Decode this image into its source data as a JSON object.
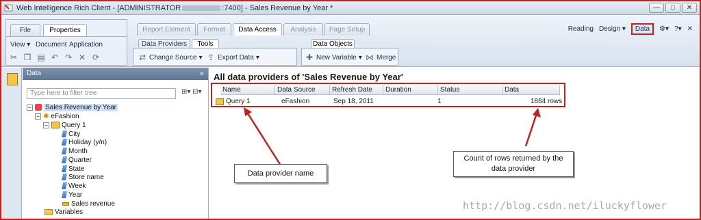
{
  "window": {
    "title_prefix": "Web Intelligence Rich Client - [ADMINISTRATOR",
    "title_suffix": ":7400] - Sales Revenue by Year *",
    "minimize": "—",
    "maximize": "□",
    "close": "✕"
  },
  "left_ribbon": {
    "tabs": [
      "File",
      "Properties"
    ],
    "nav": [
      "View",
      "Document",
      "Application"
    ]
  },
  "main_tabs": [
    "Report Element",
    "Format",
    "Data Access",
    "Analysis",
    "Page Setup"
  ],
  "sub_tabs": [
    "Data Providers",
    "Tools"
  ],
  "data_objects_tab": "Data Objects",
  "tools": {
    "change_source": "Change Source",
    "export_data": "Export Data",
    "new_variable": "New Variable",
    "merge": "Merge"
  },
  "right_tools": {
    "reading": "Reading",
    "design": "Design",
    "data": "Data"
  },
  "data_panel": {
    "header": "Data",
    "collapse": "«",
    "filter_placeholder": "Type here to filter tree",
    "tree": {
      "root": "Sales Revenue by Year",
      "universe": "eFashion",
      "query": "Query 1",
      "objects": [
        "City",
        "Holiday (y/n)",
        "Month",
        "Quarter",
        "State",
        "Store name",
        "Week",
        "Year",
        "Sales revenue"
      ],
      "variables": "Variables"
    }
  },
  "main": {
    "heading": "All data providers of 'Sales Revenue by Year'",
    "columns": [
      "Name",
      "Data Source",
      "Refresh Date",
      "Duration",
      "Status",
      "Data"
    ],
    "rows": [
      {
        "name": "Query 1",
        "source": "eFashion",
        "refresh": "Sep 18, 2011",
        "duration": "",
        "status": "1",
        "data": "1884 rows"
      }
    ]
  },
  "callouts": {
    "provider_name": "Data provider name",
    "row_count": "Count of rows returned by the data provider"
  },
  "watermark": "http://blog.csdn.net/iluckyflower",
  "colors": {
    "accent_red": "#c42020",
    "panel_header": "#6a809c",
    "ribbon": "#dfe7f1"
  }
}
